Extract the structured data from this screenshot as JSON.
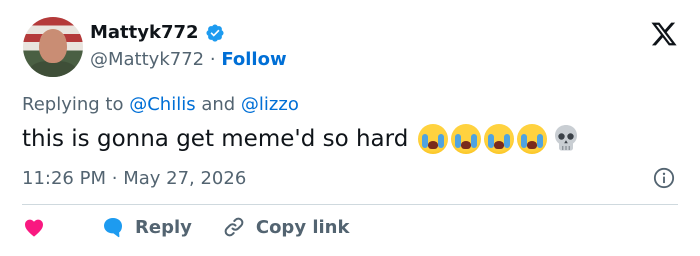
{
  "user": {
    "display_name": "Mattyk772",
    "handle": "@Mattyk772",
    "separator": "·",
    "follow_label": "Follow"
  },
  "reply_context": {
    "prefix": "Replying to",
    "mention1": "@Chilis",
    "conjunction": "and",
    "mention2": "@lizzo"
  },
  "tweet": {
    "text": "this is gonna get meme'd so hard",
    "emojis": [
      "loudly-crying-face",
      "loudly-crying-face",
      "loudly-crying-face",
      "loudly-crying-face",
      "skull"
    ]
  },
  "meta": {
    "time": "11:26 PM",
    "separator": "·",
    "date": "May 27, 2026"
  },
  "actions": {
    "reply_label": "Reply",
    "copy_link_label": "Copy link"
  },
  "colors": {
    "link": "#006fd6",
    "like": "#f91880",
    "reply": "#1d9bf0",
    "muted": "#536471",
    "text": "#0f1419",
    "verified": "#1d9bf0"
  }
}
